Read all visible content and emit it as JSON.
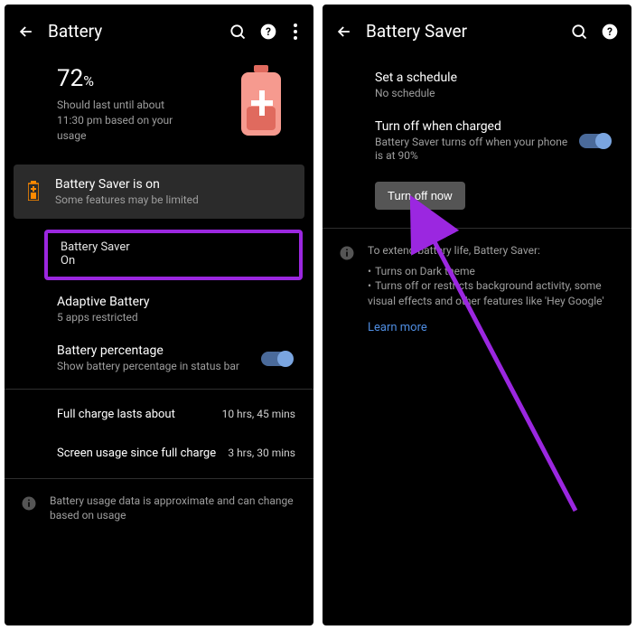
{
  "left": {
    "header": {
      "title": "Battery"
    },
    "stats": {
      "percent": "72",
      "percent_sign": "%",
      "summary": "Should last until about 11:30 pm based on your usage"
    },
    "banner": {
      "title": "Battery Saver is on",
      "sub": "Some features may be limited"
    },
    "battery_saver": {
      "title": "Battery Saver",
      "sub": "On"
    },
    "adaptive": {
      "title": "Adaptive Battery",
      "sub": "5 apps restricted"
    },
    "percentage": {
      "title": "Battery percentage",
      "sub": "Show battery percentage in status bar"
    },
    "full_charge": {
      "label": "Full charge lasts about",
      "value": "10 hrs, 45 mins"
    },
    "screen_usage": {
      "label": "Screen usage since full charge",
      "value": "3 hrs, 30 mins"
    },
    "footer_info": "Battery usage data is approximate and can change based on usage"
  },
  "right": {
    "header": {
      "title": "Battery Saver"
    },
    "schedule": {
      "title": "Set a schedule",
      "sub": "No schedule"
    },
    "turnoff_charged": {
      "title": "Turn off when charged",
      "sub": "Battery Saver turns off when your phone is at 90%"
    },
    "turn_off_now": "Turn off now",
    "info": {
      "lead": "To extend battery life, Battery Saver:",
      "b1": "Turns on Dark theme",
      "b2": "Turns off or restricts background activity, some visual effects and other features like 'Hey Google'",
      "learn_more": "Learn more"
    }
  }
}
